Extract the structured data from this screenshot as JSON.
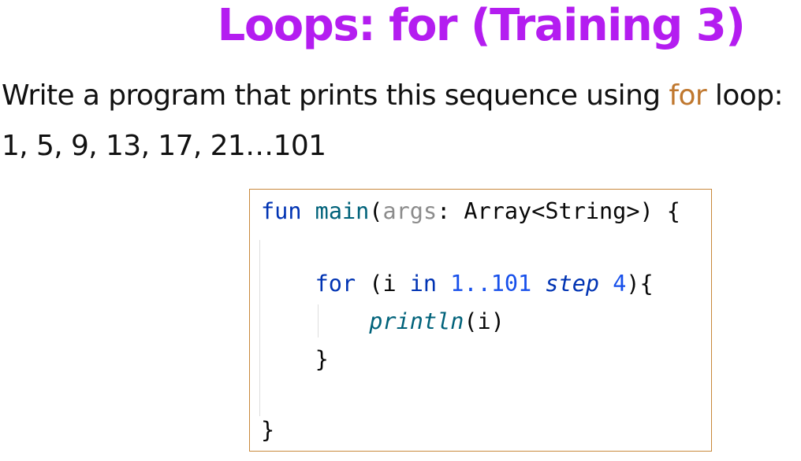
{
  "title": "Loops: for (Training 3)",
  "instruction": {
    "before": "Write a program that prints this sequence using ",
    "keyword": "for",
    "after": " loop:"
  },
  "sequence": "1, 5, 9, 13, 17, 21…101",
  "code": {
    "line1": {
      "kw": "fun",
      "fn": "main",
      "open": "(",
      "param": "args",
      "rest": ": Array<String>) {"
    },
    "line3": {
      "indent": "    ",
      "kw": "for",
      "open": " (i ",
      "in": "in",
      "space": " ",
      "range": "1..101",
      "space2": " ",
      "step": "step",
      "space3": " ",
      "num": "4",
      "close": "){"
    },
    "line4": {
      "indent": "        ",
      "call": "println",
      "args": "(i)"
    },
    "line5": "    }",
    "line7": "}"
  }
}
